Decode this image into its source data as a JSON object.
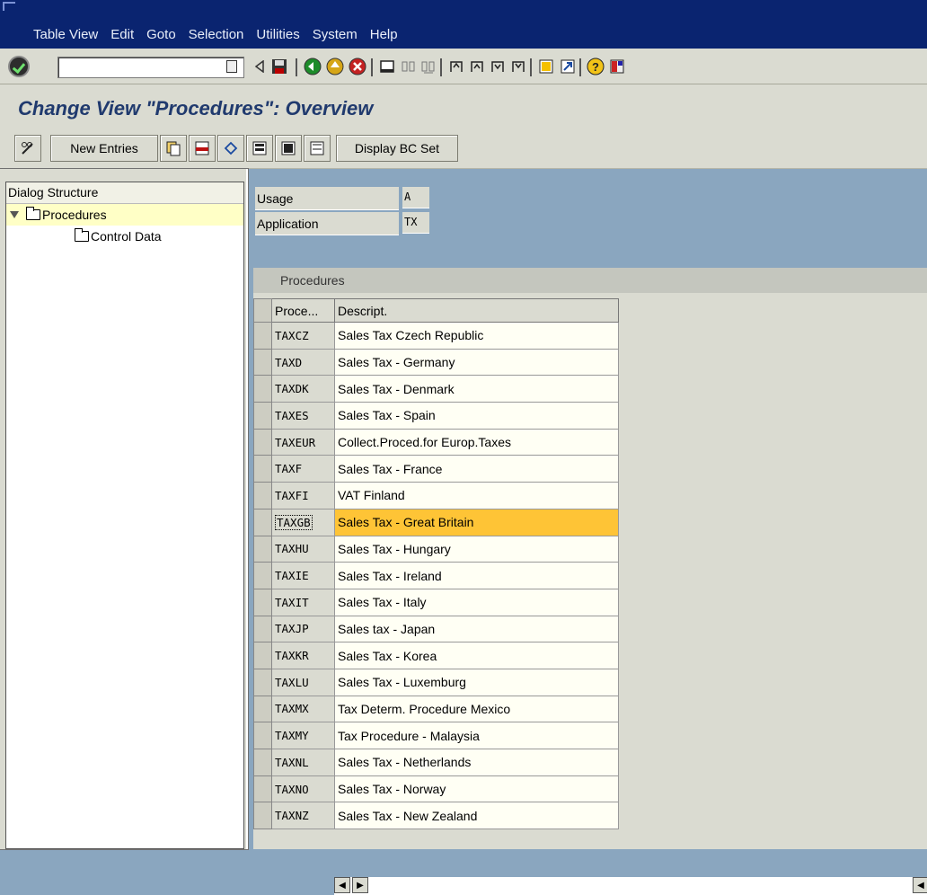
{
  "menu": {
    "items": [
      "Table View",
      "Edit",
      "Goto",
      "Selection",
      "Utilities",
      "System",
      "Help"
    ]
  },
  "toolbar": {
    "command_field_value": ""
  },
  "page": {
    "title": "Change View \"Procedures\": Overview"
  },
  "app_toolbar": {
    "new_entries": "New Entries",
    "display_bc_set": "Display BC Set"
  },
  "dialog_structure": {
    "header": "Dialog Structure",
    "items": [
      "Procedures",
      "Control Data"
    ]
  },
  "fields": {
    "usage_label": "Usage",
    "usage_value": "A",
    "application_label": "Application",
    "application_value": "TX"
  },
  "table": {
    "title": "Procedures",
    "columns": [
      "Proce...",
      "Descript."
    ],
    "rows": [
      [
        "TAXCZ",
        "Sales Tax Czech Republic"
      ],
      [
        "TAXD",
        "Sales Tax - Germany"
      ],
      [
        "TAXDK",
        "Sales Tax - Denmark"
      ],
      [
        "TAXES",
        "Sales Tax - Spain"
      ],
      [
        "TAXEUR",
        "Collect.Proced.for Europ.Taxes"
      ],
      [
        "TAXF",
        "Sales Tax - France"
      ],
      [
        "TAXFI",
        "VAT Finland"
      ],
      [
        "TAXGB",
        "Sales Tax - Great Britain"
      ],
      [
        "TAXHU",
        "Sales Tax - Hungary"
      ],
      [
        "TAXIE",
        "Sales Tax - Ireland"
      ],
      [
        "TAXIT",
        "Sales Tax - Italy"
      ],
      [
        "TAXJP",
        "Sales tax - Japan"
      ],
      [
        "TAXKR",
        "Sales Tax - Korea"
      ],
      [
        "TAXLU",
        "Sales Tax - Luxemburg"
      ],
      [
        "TAXMX",
        "Tax Determ. Procedure Mexico"
      ],
      [
        "TAXMY",
        "Tax Procedure - Malaysia"
      ],
      [
        "TAXNL",
        "Sales Tax - Netherlands"
      ],
      [
        "TAXNO",
        "Sales Tax - Norway"
      ],
      [
        "TAXNZ",
        "Sales Tax - New Zealand"
      ]
    ],
    "highlighted_row": 7
  },
  "colors": {
    "menubar_bg": "#0a2470",
    "highlight": "#fec436",
    "tree_selected": "#ffffc6"
  }
}
